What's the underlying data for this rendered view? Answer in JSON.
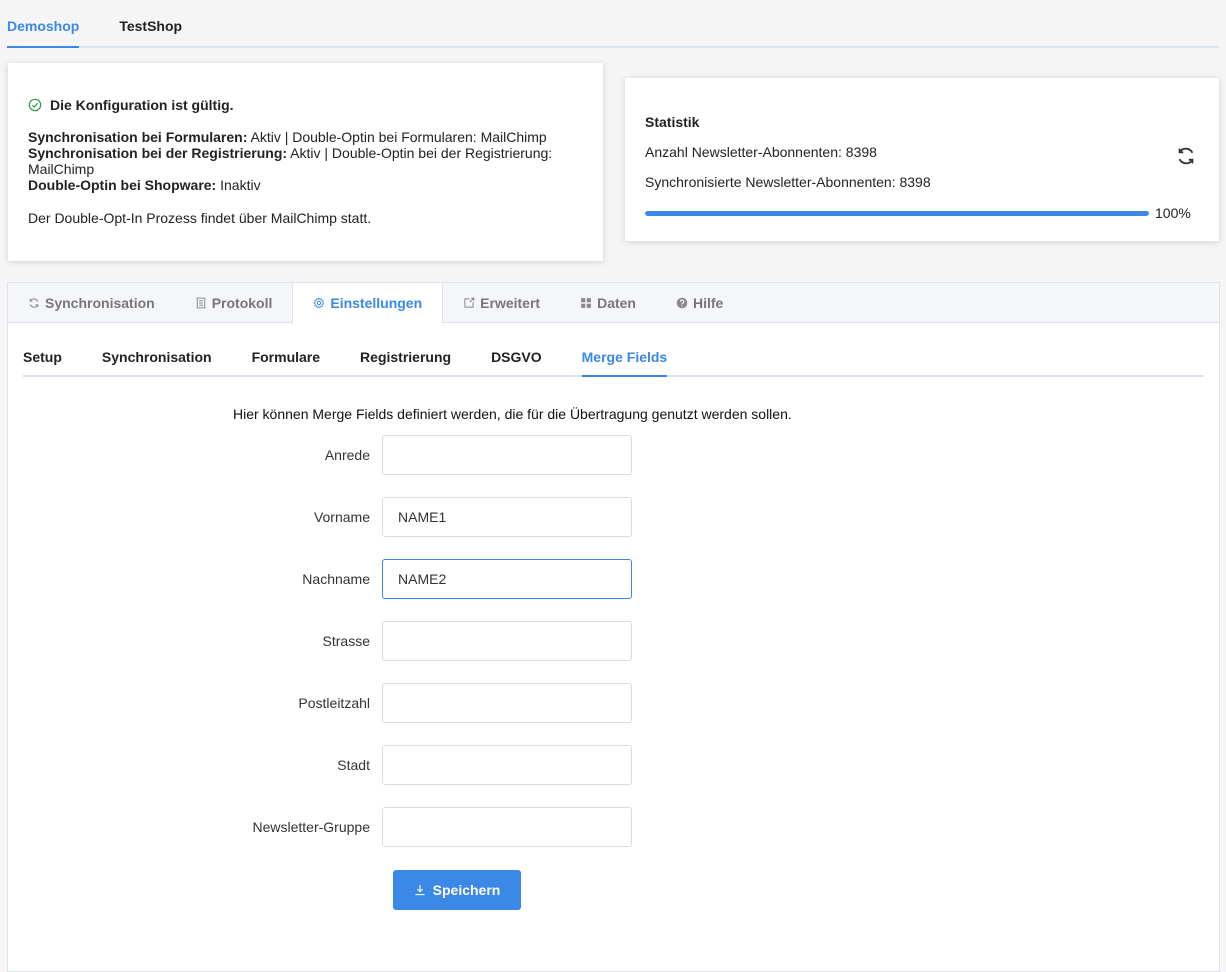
{
  "shop_tabs": [
    {
      "label": "Demoshop",
      "active": true
    },
    {
      "label": "TestShop",
      "active": false
    }
  ],
  "config": {
    "status": "Die Konfiguration ist gültig.",
    "forms_label": "Synchronisation bei Formularen:",
    "forms_value": "Aktiv | Double-Optin bei Formularen: MailChimp",
    "registration_label": "Synchronisation bei der Registrierung:",
    "registration_value": "Aktiv | Double-Optin bei der Registrierung: MailChimp",
    "shopware_label": "Double-Optin bei Shopware:",
    "shopware_value": "Inaktiv",
    "note": "Der Double-Opt-In Prozess findet über MailChimp statt."
  },
  "statistics": {
    "title": "Statistik",
    "subscribers": "Anzahl Newsletter-Abonnenten: 8398",
    "synced": "Synchronisierte Newsletter-Abonnenten: 8398",
    "progress_percent": 100,
    "progress_label": "100%"
  },
  "main_tabs": [
    {
      "label": "Synchronisation",
      "icon": "sync-icon",
      "active": false
    },
    {
      "label": "Protokoll",
      "icon": "document-icon",
      "active": false
    },
    {
      "label": "Einstellungen",
      "icon": "gear-icon",
      "active": true
    },
    {
      "label": "Erweitert",
      "icon": "external-icon",
      "active": false
    },
    {
      "label": "Daten",
      "icon": "grid-icon",
      "active": false
    },
    {
      "label": "Hilfe",
      "icon": "help-icon",
      "active": false
    }
  ],
  "sub_tabs": [
    {
      "label": "Setup",
      "active": false
    },
    {
      "label": "Synchronisation",
      "active": false
    },
    {
      "label": "Formulare",
      "active": false
    },
    {
      "label": "Registrierung",
      "active": false
    },
    {
      "label": "DSGVO",
      "active": false
    },
    {
      "label": "Merge Fields",
      "active": true
    }
  ],
  "merge_fields": {
    "intro": "Hier können Merge Fields definiert werden, die für die Übertragung genutzt werden sollen.",
    "fields": [
      {
        "label": "Anrede",
        "value": ""
      },
      {
        "label": "Vorname",
        "value": "NAME1"
      },
      {
        "label": "Nachname",
        "value": "NAME2",
        "focused": true
      },
      {
        "label": "Strasse",
        "value": ""
      },
      {
        "label": "Postleitzahl",
        "value": ""
      },
      {
        "label": "Stadt",
        "value": ""
      },
      {
        "label": "Newsletter-Gruppe",
        "value": ""
      }
    ],
    "save_label": "Speichern"
  },
  "colors": {
    "accent": "#3b88e6",
    "success": "#2e9d4f"
  }
}
